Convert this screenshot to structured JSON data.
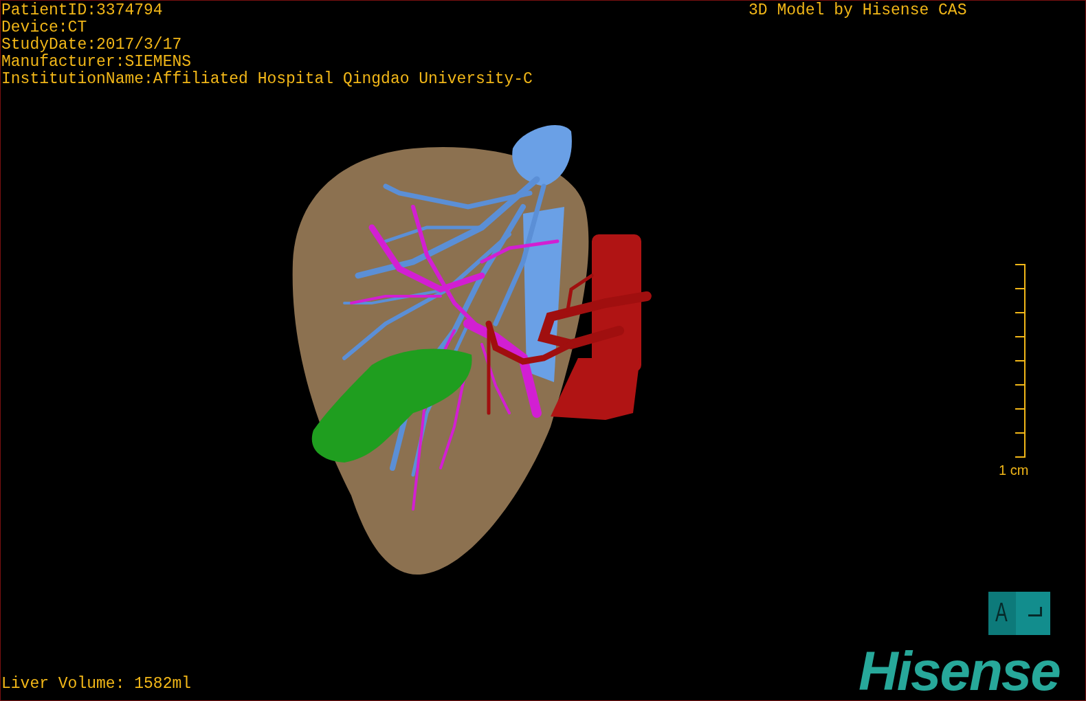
{
  "patient_info": [
    "PatientID:3374794",
    "Device:CT",
    "StudyDate:2017/3/17",
    "Manufacturer:SIEMENS",
    "InstitutionName:Affiliated Hospital Qingdao University-C"
  ],
  "title": "3D Model by Hisense CAS",
  "scale_bar": {
    "label": "1 cm"
  },
  "orientation_cube": {
    "label": "A"
  },
  "logo": "Hisense",
  "liver_volume": "Liver Volume: 1582ml"
}
